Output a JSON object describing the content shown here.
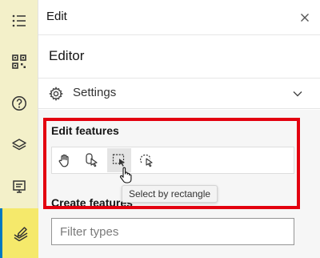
{
  "rail": {
    "items": [
      {
        "icon": "layer-list-icon"
      },
      {
        "icon": "qr-grid-icon"
      },
      {
        "icon": "help-icon"
      },
      {
        "icon": "layers-icon"
      },
      {
        "icon": "presentation-icon"
      },
      {
        "icon": "pencil-layers-icon",
        "active": true
      }
    ]
  },
  "header": {
    "title": "Edit",
    "close_icon": "close-icon"
  },
  "editor": {
    "title": "Editor"
  },
  "settings": {
    "label": "Settings",
    "icon": "gear-icon",
    "chevron": "chevron-down-icon"
  },
  "edit_features": {
    "title": "Edit features",
    "tools": [
      {
        "icon": "pan-hand-icon"
      },
      {
        "icon": "select-feature-icon"
      },
      {
        "icon": "select-rectangle-icon",
        "pressed": true
      },
      {
        "icon": "select-lasso-icon"
      }
    ],
    "tooltip": "Select by rectangle"
  },
  "create_features": {
    "title": "Create features",
    "filter_placeholder": "Filter types"
  },
  "colors": {
    "highlight": "#e3000f",
    "rail_bg": "#f3f0c9",
    "rail_active": "#f5e96b"
  }
}
